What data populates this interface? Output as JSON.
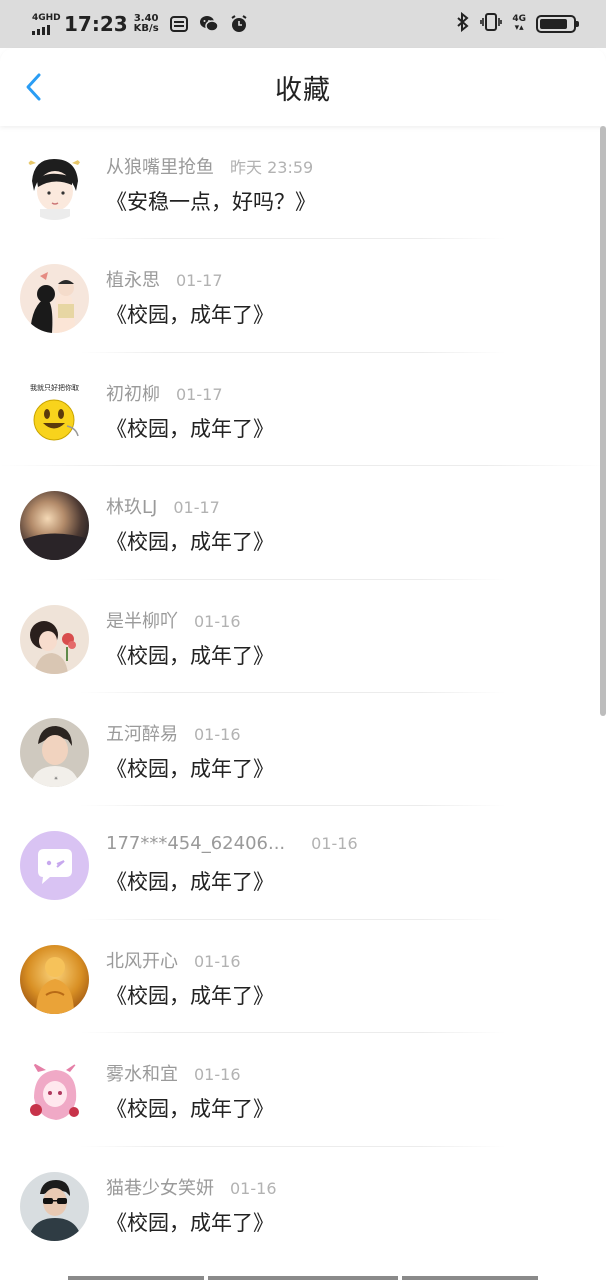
{
  "status_bar": {
    "network": "4GHD",
    "time": "17:23",
    "speed_value": "3.40",
    "speed_unit": "KB/s",
    "signal_right": "4G"
  },
  "header": {
    "title": "收藏"
  },
  "list": [
    {
      "name": "从狼嘴里抢鱼",
      "time": "昨天 23:59",
      "content": "《安稳一点，好吗？》",
      "avatar_icon": "cartoon-boy-avatar"
    },
    {
      "name": "植永思",
      "time": "01-17",
      "content": "《校园，成年了》",
      "avatar_icon": "couple-illustration-avatar"
    },
    {
      "name": "初初柳",
      "time": "01-17",
      "content": "《校园，成年了》",
      "avatar_icon": "smiley-emoji-avatar",
      "avatar_caption": "我就只好把你取"
    },
    {
      "name": "林玖LJ",
      "time": "01-17",
      "content": "《校园，成年了》",
      "avatar_icon": "sunset-photo-avatar"
    },
    {
      "name": "是半柳吖",
      "time": "01-16",
      "content": "《校园，成年了》",
      "avatar_icon": "girl-with-flower-avatar"
    },
    {
      "name": "五河醉易",
      "time": "01-16",
      "content": "《校园，成年了》",
      "avatar_icon": "boy-photo-avatar"
    },
    {
      "name": "177***454_62406...",
      "time": "01-16",
      "content": "《校园，成年了》",
      "avatar_icon": "default-chat-avatar"
    },
    {
      "name": "北风开心",
      "time": "01-16",
      "content": "《校园，成年了》",
      "avatar_icon": "golden-buddha-avatar"
    },
    {
      "name": "雾水和宜",
      "time": "01-16",
      "content": "《校园，成年了》",
      "avatar_icon": "anime-fox-girl-avatar"
    },
    {
      "name": "猫巷少女笑妍",
      "time": "01-16",
      "content": "《校园，成年了》",
      "avatar_icon": "man-sunglasses-avatar"
    }
  ],
  "colors": {
    "accent": "#2a9df4",
    "name_text": "#9a9a9a",
    "time_text": "#b2b2b2",
    "content_text": "#222222",
    "status_bar_bg": "#dcdcdc"
  }
}
